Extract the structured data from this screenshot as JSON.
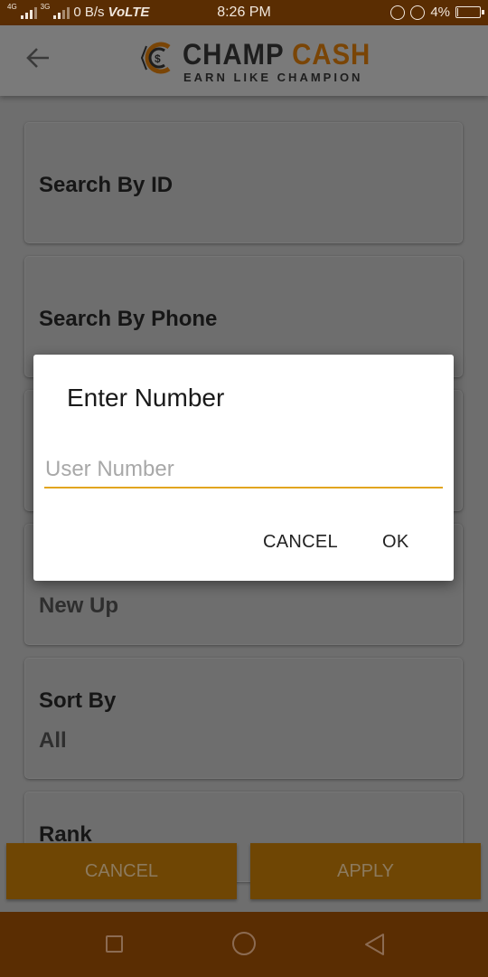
{
  "status_bar": {
    "network_4g": "4G",
    "network_3g": "3G",
    "speed": "0 B/s",
    "volte": "VoLTE",
    "time": "8:26 PM",
    "battery_percent": "4%",
    "battery_level": 0.04,
    "icons": [
      "signal-icon",
      "alarm-icon",
      "rotation-lock-icon",
      "battery-icon"
    ]
  },
  "header": {
    "back_icon": "back-arrow-icon",
    "logo": {
      "title_part1": "CHAMP",
      "title_part2": "CASH",
      "tagline": "EARN LIKE CHAMPION"
    }
  },
  "filters": {
    "search_by_id": "Search By ID",
    "search_by_phone": "Search By Phone",
    "new_up_value": "New Up",
    "sort_by_label": "Sort By",
    "sort_by_value": "All",
    "rank_label": "Rank"
  },
  "actions": {
    "cancel": "CANCEL",
    "apply": "APPLY"
  },
  "dialog": {
    "title": "Enter Number",
    "input_placeholder": "User Number",
    "input_value": "",
    "cancel": "CANCEL",
    "ok": "OK"
  },
  "colors": {
    "status_bar": "#5a2d02",
    "accent": "#e2a51f",
    "brand_orange": "#7a4506",
    "overlay_gray": "#6e6e6e"
  }
}
